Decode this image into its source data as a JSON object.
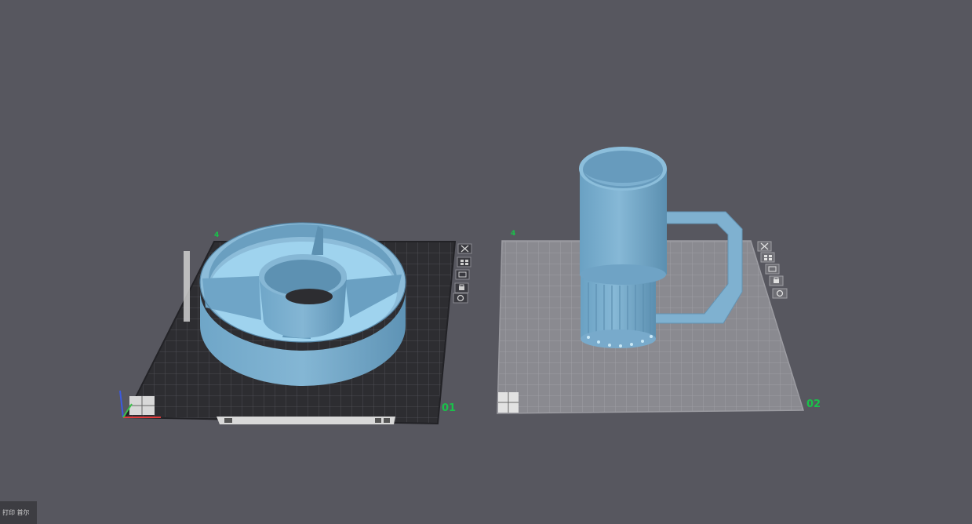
{
  "colors": {
    "background": "#57575f",
    "model": "#7fb0cf",
    "model_dark": "#5f93b4",
    "model_inner": "#92c7e6",
    "plate_dark": "#2d2d31",
    "plate_light": "#8a8a90",
    "plate_label": "#19c24a"
  },
  "plates": [
    {
      "label": "01",
      "corner_tag": "4",
      "state": "selected",
      "icons": [
        "close-icon",
        "arrange-icon",
        "orient-icon",
        "lock-icon",
        "settings-icon"
      ]
    },
    {
      "label": "02",
      "corner_tag": "4",
      "state": "unselected",
      "icons": [
        "close-icon",
        "arrange-icon",
        "orient-icon",
        "lock-icon",
        "settings-icon"
      ]
    }
  ],
  "objects": [
    {
      "name": "divided-round-tray",
      "plate": "01"
    },
    {
      "name": "tall-mug-with-handle",
      "plate": "02"
    }
  ],
  "status_bar": {
    "text": "打印 首尔"
  }
}
